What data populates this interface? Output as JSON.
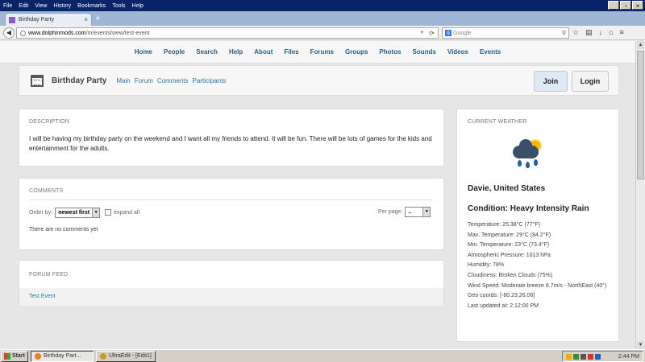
{
  "browser": {
    "menu": [
      "File",
      "Edit",
      "View",
      "History",
      "Bookmarks",
      "Tools",
      "Help"
    ],
    "tab_title": "Birthday Party",
    "url_domain": "www.dolphinmods.com",
    "url_path": "/m/events/view/test-event",
    "search_placeholder": "Google"
  },
  "site_nav": [
    "Home",
    "People",
    "Search",
    "Help",
    "About",
    "Files",
    "Forums",
    "Groups",
    "Photos",
    "Sounds",
    "Videos",
    "Events"
  ],
  "event": {
    "title": "Birthday Party",
    "links": [
      "Main",
      "Forum",
      "Comments",
      "Participants"
    ],
    "join_label": "Join",
    "login_label": "Login"
  },
  "description": {
    "heading": "DESCRIPTION",
    "text": "I will be having my birthday party on the weekend and I want all my friends to attend. It will be fun. There will be lots of games for the kids and entertainment for the adults."
  },
  "comments": {
    "heading": "COMMENTS",
    "order_label": "Order by:",
    "order_value": "newest first",
    "expand_label": "expand all",
    "per_page_label": "Per page:",
    "per_page_value": "..",
    "empty_text": "There are no comments yet"
  },
  "forum": {
    "heading": "FORUM FEED",
    "items": [
      "Test Event"
    ]
  },
  "weather": {
    "heading": "CURRENT WEATHER",
    "location": "Davie, United States",
    "condition": "Condition: Heavy Intensity Rain",
    "lines": [
      "Temperature: 25.38°C (77°F)",
      "Max. Temperature: 29°C (84.2°F)",
      "Min. Temperature: 23°C (73.4°F)",
      "Atmospheric Pressure: 1013 hPa",
      "Humidity: 78%",
      "Cloudiness: Broken Clouds (75%)",
      "Wind Speed: Moderate breeze 6.7m/s - NorthEast (40°)",
      "Geo coords: [-80.23,26.06]",
      "Last updated at: 2:12:00 PM"
    ]
  },
  "taskbar": {
    "start": "Start",
    "items": [
      "Birthday Part...",
      "UltraEdit - [Edit1]"
    ],
    "clock": "2:44 PM"
  }
}
